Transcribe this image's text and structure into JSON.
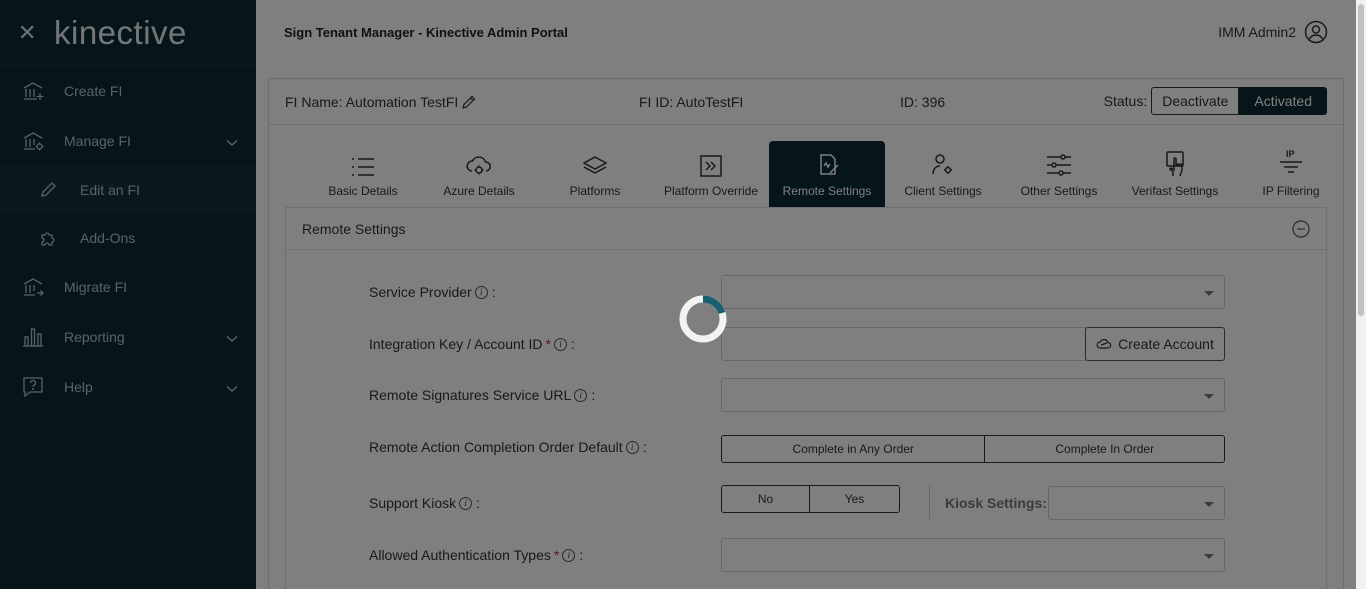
{
  "app": {
    "brand": "kinective",
    "page_title": "Sign Tenant Manager - Kinective Admin Portal",
    "user": "IMM Admin2"
  },
  "sidebar": {
    "items": [
      {
        "label": "Create FI",
        "icon": "bank-plus-icon"
      },
      {
        "label": "Manage FI",
        "icon": "bank-gear-icon",
        "expanded": true
      },
      {
        "label": "Edit an FI",
        "icon": "pencil-icon",
        "sub": true,
        "active": true
      },
      {
        "label": "Add-Ons",
        "icon": "puzzle-icon",
        "sub": true
      },
      {
        "label": "Migrate FI",
        "icon": "bank-arrow-icon"
      },
      {
        "label": "Reporting",
        "icon": "bar-chart-icon"
      },
      {
        "label": "Help",
        "icon": "help-bubble-icon"
      }
    ]
  },
  "fi": {
    "name_label": "FI Name: Automation TestFI",
    "id_label": "FI ID: AutoTestFI",
    "num_label": "ID: 396",
    "status_label": "Status:",
    "deactivate_label": "Deactivate",
    "activated_label": "Activated"
  },
  "tabs": [
    {
      "label": "Basic Details",
      "icon": "list-icon"
    },
    {
      "label": "Azure Details",
      "icon": "cloud-gear-icon"
    },
    {
      "label": "Platforms",
      "icon": "layers-icon"
    },
    {
      "label": "Platform Override",
      "icon": "arrow-box-icon"
    },
    {
      "label": "Remote Settings",
      "icon": "remote-sign-icon",
      "active": true
    },
    {
      "label": "Client Settings",
      "icon": "user-gear-icon"
    },
    {
      "label": "Other Settings",
      "icon": "sliders-icon"
    },
    {
      "label": "Verifast Settings",
      "icon": "hand-touch-icon"
    },
    {
      "label": "IP Filtering",
      "icon": "ip-filter-icon"
    }
  ],
  "section": {
    "title": "Remote Settings",
    "fields": {
      "service_provider": "Service Provider",
      "integration_key": "Integration Key / Account ID",
      "create_account": "Create Account",
      "remote_url": "Remote Signatures Service URL",
      "completion_order": "Remote Action Completion Order Default",
      "order_any": "Complete in Any Order",
      "order_in": "Complete In Order",
      "support_kiosk": "Support Kiosk",
      "kiosk_no": "No",
      "kiosk_yes": "Yes",
      "kiosk_settings": "Kiosk Settings:",
      "auth_types": "Allowed Authentication Types"
    },
    "colon": ":",
    "required_mark": "*",
    "info_mark": "i"
  },
  "colors": {
    "sidebar_bg": "#0d2a33",
    "accent": "#0d2a33",
    "spinner": "#1a5f6e",
    "required": "#c0392b"
  }
}
